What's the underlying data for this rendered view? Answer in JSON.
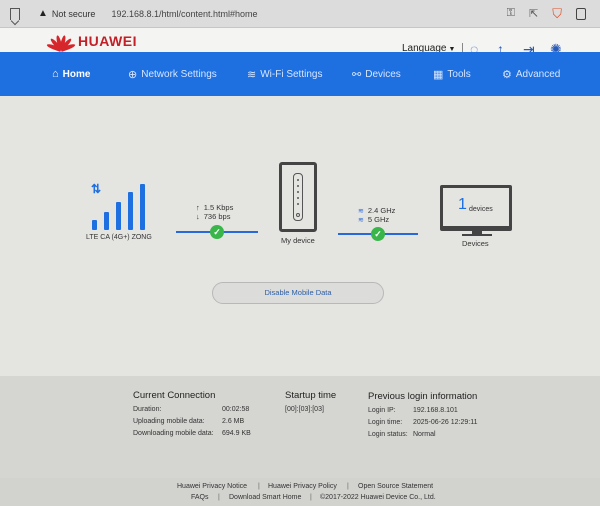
{
  "browser": {
    "security_label": "Not secure",
    "url": "192.168.8.1/html/content.html#home"
  },
  "header": {
    "brand": "HUAWEI",
    "language_label": "Language",
    "brand_color": "#c21f26"
  },
  "nav": {
    "accent_color": "#1e6fe0",
    "items": [
      {
        "label": "Home",
        "icon": "home-icon",
        "active": true
      },
      {
        "label": "Network Settings",
        "icon": "globe-icon",
        "active": false
      },
      {
        "label": "Wi-Fi Settings",
        "icon": "wifi-icon",
        "active": false
      },
      {
        "label": "Devices",
        "icon": "devices-icon",
        "active": false
      },
      {
        "label": "Tools",
        "icon": "tools-icon",
        "active": false
      },
      {
        "label": "Advanced",
        "icon": "gear-icon",
        "active": false
      }
    ]
  },
  "status": {
    "network_type": "LTE CA (4G+) ZONG",
    "upload_rate": "1.5 Kbps",
    "download_rate": "736 bps",
    "device_label": "My device",
    "band_1": "2.4 GHz",
    "band_2": "5 GHz",
    "connected_devices": "1",
    "devices_word": "devices",
    "devices_label": "Devices",
    "disable_button": "Disable Mobile Data"
  },
  "current_connection": {
    "title": "Current Connection",
    "rows": [
      {
        "label": "Duration:",
        "value": "00:02:58"
      },
      {
        "label": "Uploading mobile data:",
        "value": "2.6 MB"
      },
      {
        "label": "Downloading mobile data:",
        "value": "694.9 KB"
      }
    ]
  },
  "startup": {
    "title": "Startup time",
    "value": "[00]:[03]:[03]"
  },
  "previous_login": {
    "title": "Previous login information",
    "rows": [
      {
        "label": "Login IP:",
        "value": "192.168.8.101"
      },
      {
        "label": "Login time:",
        "value": "2025-06-26 12:29:11"
      },
      {
        "label": "Login status:",
        "value": "Normal"
      }
    ]
  },
  "footer": {
    "links": [
      "Huawei Privacy Notice",
      "Huawei Privacy Policy",
      "Open Source Statement",
      "FAQs",
      "Download Smart Home"
    ],
    "copyright": "©2017-2022 Huawei Device Co., Ltd."
  }
}
